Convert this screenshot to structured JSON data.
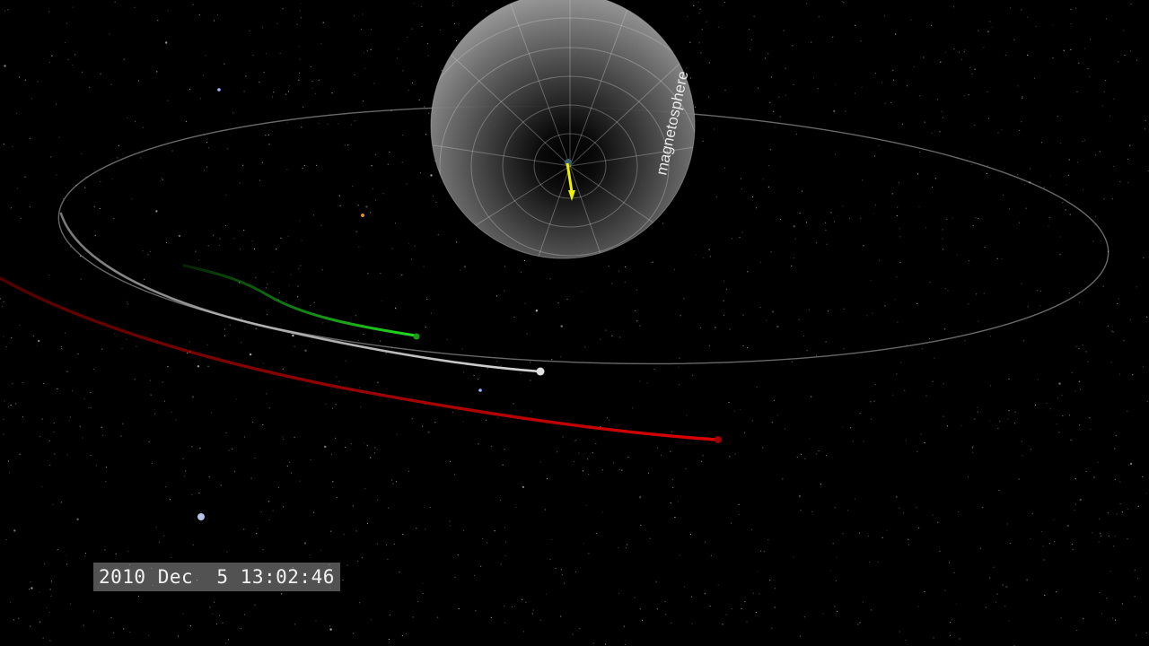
{
  "scene": {
    "background_color": "#000000",
    "sphere_label": "magnetosphere",
    "sphere_color": "#8a8a8a",
    "orbit_color": "#bdbdbd",
    "track_colors": {
      "green": "#22e022",
      "white": "#d0d0d0",
      "red": "#e00000"
    },
    "vector_color": "#f0f000"
  },
  "timestamp": {
    "text": "2010 Dec  5 13:02:46"
  }
}
